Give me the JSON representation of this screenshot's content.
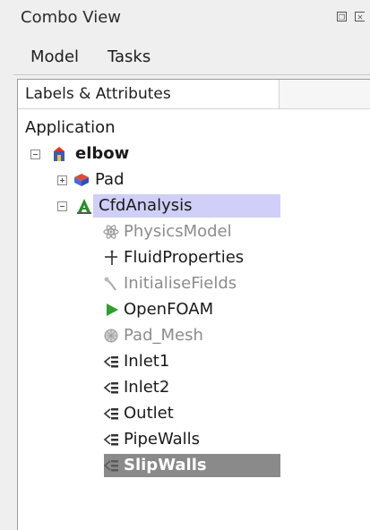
{
  "window": {
    "title": "Combo View"
  },
  "tabs": [
    {
      "label": "Model"
    },
    {
      "label": "Tasks"
    }
  ],
  "tree": {
    "header": "Labels & Attributes",
    "root": "Application",
    "document": "elbow",
    "items": {
      "pad": "Pad",
      "analysis": "CfdAnalysis",
      "physics": "PhysicsModel",
      "fluid": "FluidProperties",
      "init": "InitialiseFields",
      "solver": "OpenFOAM",
      "mesh": "Pad_Mesh",
      "inlet1": "Inlet1",
      "inlet2": "Inlet2",
      "outlet": "Outlet",
      "pipewalls": "PipeWalls",
      "slipwalls": "SlipWalls"
    }
  },
  "colors": {
    "selection_highlight": "#cfcff7",
    "current_selection": "#8a8a8a",
    "solver_play": "#2e9e2e",
    "analysis_icon": "#2e8b2e"
  }
}
